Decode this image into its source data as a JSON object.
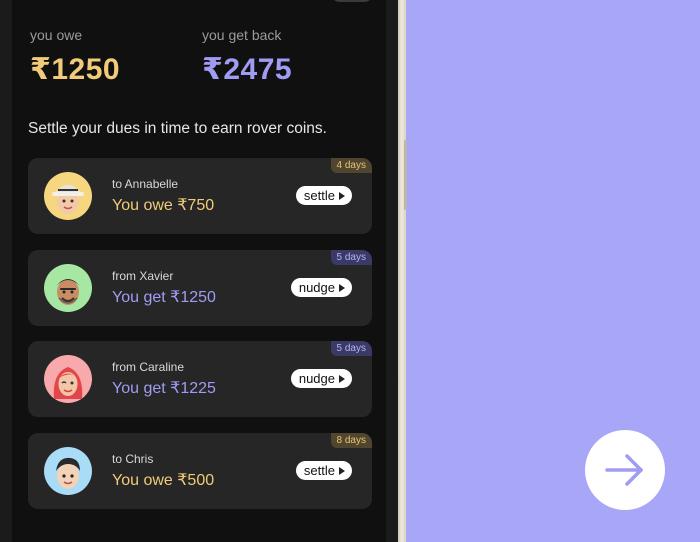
{
  "summary": {
    "owe_label": "you owe",
    "owe_amount": "₹1250",
    "get_label": "you get back",
    "get_amount": "₹2475"
  },
  "tagline": "Settle your dues in time to earn rover coins.",
  "dues": [
    {
      "direction": "to Annabelle",
      "amount_text": "You owe ₹750",
      "days": "4 days",
      "action": "settle",
      "kind": "owe",
      "avatar": "annabelle-avatar"
    },
    {
      "direction": "from Xavier",
      "amount_text": "You get ₹1250",
      "days": "5 days",
      "action": "nudge",
      "kind": "get",
      "avatar": "xavier-avatar"
    },
    {
      "direction": "from Caraline",
      "amount_text": "You get ₹1225",
      "days": "5 days",
      "action": "nudge",
      "kind": "get",
      "avatar": "caraline-avatar"
    },
    {
      "direction": "to Chris",
      "amount_text": "You owe ₹500",
      "days": "8 days",
      "action": "settle",
      "kind": "owe",
      "avatar": "chris-avatar"
    }
  ],
  "next_button": {
    "icon": "arrow-right-icon"
  },
  "colors": {
    "background": "#a8a6f7",
    "screen": "#101010",
    "card": "#262626",
    "owe_accent": "#f1cb79",
    "get_accent": "#a09cf4"
  }
}
